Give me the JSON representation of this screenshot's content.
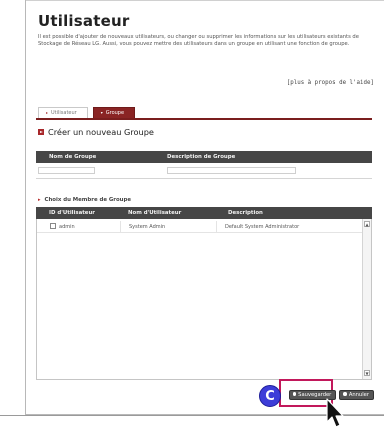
{
  "page": {
    "title": "Utilisateur",
    "intro": "Il est possible d'ajouter de nouveaux utilisateurs, ou changer ou supprimer les informations sur les utilisateurs existants de Stockage de Réseau LG. Aussi, vous pouvez mettre des utilisateurs dans un groupe en utilisant une fonction de groupe.",
    "help_link": "[plus à propos de l'aide]"
  },
  "tabs": [
    {
      "label": "Utilisateur",
      "active": false
    },
    {
      "label": "Groupe",
      "active": true
    }
  ],
  "create_group": {
    "title": "Créer un nouveau Groupe",
    "col_name": "Nom de Groupe",
    "col_description": "Description de Groupe",
    "name_value": "",
    "description_value": ""
  },
  "members": {
    "title": "Choix du Membre de Groupe",
    "columns": [
      "ID d'Utilisateur",
      "Nom d'Utilisateur",
      "Description"
    ],
    "rows": [
      {
        "id": "admin",
        "name": "System Admin",
        "description": "Default System Administrator",
        "checked": false
      }
    ]
  },
  "buttons": {
    "save": "Sauvegarder",
    "cancel": "Annuler"
  },
  "annotation": {
    "marker": "C",
    "highlight_color": "#c2185b",
    "marker_color": "#3d3dd8"
  },
  "colors": {
    "accent": "#8a2424",
    "header_bar": "#464646"
  }
}
